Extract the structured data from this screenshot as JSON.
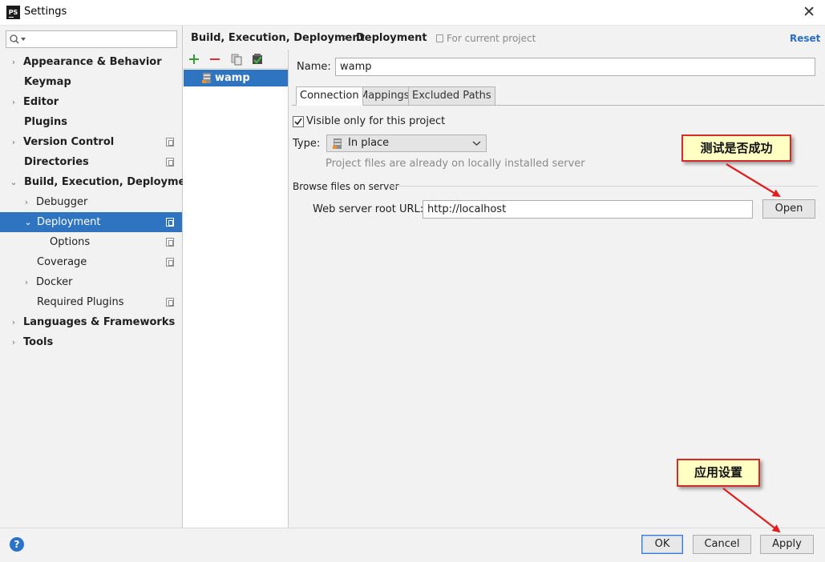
{
  "window": {
    "title": "Settings",
    "app_icon": "PS",
    "close_glyph": "✕"
  },
  "search": {
    "placeholder": "",
    "value": ""
  },
  "sidebar": {
    "items": [
      {
        "label": "Appearance & Behavior",
        "arrow": "›",
        "bold": true
      },
      {
        "label": "Keymap",
        "arrow": "",
        "bold": true
      },
      {
        "label": "Editor",
        "arrow": "›",
        "bold": true
      },
      {
        "label": "Plugins",
        "arrow": "",
        "bold": true
      },
      {
        "label": "Version Control",
        "arrow": "›",
        "bold": true
      },
      {
        "label": "Directories",
        "arrow": "",
        "bold": true
      },
      {
        "label": "Build, Execution, Deployment",
        "arrow": "⌄",
        "bold": true
      },
      {
        "label": "Debugger",
        "arrow": "›",
        "bold": false
      },
      {
        "label": "Deployment",
        "arrow": "⌄",
        "bold": false,
        "selected": true
      },
      {
        "label": "Options",
        "arrow": "",
        "bold": false
      },
      {
        "label": "Coverage",
        "arrow": "",
        "bold": false
      },
      {
        "label": "Docker",
        "arrow": "›",
        "bold": false
      },
      {
        "label": "Required Plugins",
        "arrow": "",
        "bold": false
      },
      {
        "label": "Languages & Frameworks",
        "arrow": "›",
        "bold": true
      },
      {
        "label": "Tools",
        "arrow": "›",
        "bold": true
      }
    ]
  },
  "header": {
    "breadcrumb_parent": "Build, Execution, Deployment",
    "breadcrumb_sep": "›",
    "breadcrumb_current": "Deployment",
    "scope": "For current project",
    "reset": "Reset"
  },
  "server_list": {
    "toolbar": [
      "add-icon",
      "remove-icon",
      "copy-icon",
      "set-default-icon"
    ],
    "items": [
      {
        "label": "wamp",
        "selected": true
      }
    ]
  },
  "form": {
    "name_label": "Name:",
    "name_value": "wamp",
    "tabs": [
      {
        "label": "Connection",
        "active": true
      },
      {
        "label": "Mappings",
        "active": false
      },
      {
        "label": "Excluded Paths",
        "active": false
      }
    ],
    "visible_checkbox": {
      "label": "Visible only for this project",
      "checked": true
    },
    "type_label": "Type:",
    "type_value": "In place",
    "type_hint": "Project files are already on locally installed server",
    "group_title": "Browse files on server",
    "url_label": "Web server root URL:",
    "url_value": "http://localhost",
    "open_button": "Open"
  },
  "footer": {
    "help": "?",
    "ok": "OK",
    "cancel": "Cancel",
    "apply": "Apply"
  },
  "annotations": {
    "callout_test": "测试是否成功",
    "callout_apply": "应用设置",
    "color": "#d42a2a"
  },
  "colors": {
    "selection": "#2f74c0",
    "link": "#2a6ec5",
    "add": "#3a9a3a",
    "remove": "#d33"
  }
}
